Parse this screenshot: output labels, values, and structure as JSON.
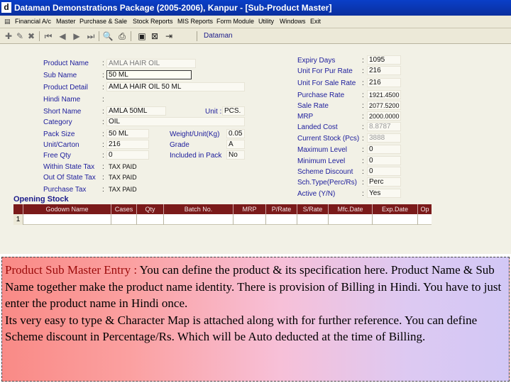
{
  "window": {
    "title": "Dataman Demonstrations Package (2005-2006), Kanpur - [Sub-Product Master]",
    "icon_glyph": "d"
  },
  "menu": {
    "items": [
      "Financial A/c",
      "Master",
      "Purchase & Sale",
      "Stock Reports",
      "MIS Reports",
      "Form Module",
      "Utility",
      "Windows",
      "Exit"
    ]
  },
  "toolbar": {
    "company": "Dataman",
    "buttons": [
      "add-icon",
      "edit-icon",
      "delete-icon",
      "first-record-icon",
      "previous-record-icon",
      "next-record-icon",
      "last-record-icon",
      "find-icon",
      "print-icon",
      "save-icon",
      "cancel-icon",
      "exit-icon"
    ]
  },
  "form_left": {
    "product_name": {
      "label": "Product Name",
      "value": "AMLA HAIR OIL"
    },
    "sub_name": {
      "label": "Sub Name",
      "value": "50 ML"
    },
    "product_detail": {
      "label": "Product Detail",
      "value": "AMLA HAIR OIL 50 ML"
    },
    "hindi_name": {
      "label": "Hindi Name",
      "value": ""
    },
    "short_name": {
      "label": "Short Name",
      "value": "AMLA 50ML"
    },
    "unit": {
      "label": "Unit :",
      "value": "PCS."
    },
    "category": {
      "label": "Category",
      "value": "OIL"
    },
    "pack_size": {
      "label": "Pack Size",
      "value": "50 ML"
    },
    "weight_unit": {
      "label": "Weight/Unit(Kg)",
      "value": "0.05"
    },
    "unit_carton": {
      "label": "Unit/Carton",
      "value": "216"
    },
    "grade": {
      "label": "Grade",
      "value": "A"
    },
    "free_qty": {
      "label": "Free Qty",
      "value": "0"
    },
    "included_in_pack": {
      "label": "Included in Pack",
      "value": "No"
    },
    "within_state_tax": {
      "label": "Within State Tax",
      "value": "TAX PAID"
    },
    "out_of_state_tax": {
      "label": "Out Of State Tax",
      "value": "TAX PAID"
    },
    "purchase_tax": {
      "label": "Purchase Tax",
      "value": "TAX PAID"
    }
  },
  "form_right": {
    "expiry_days": {
      "label": "Expiry Days",
      "value": "1095"
    },
    "unit_for_pur_rate": {
      "label": "Unit For Pur Rate",
      "value": "216"
    },
    "unit_for_sale_rate": {
      "label": "Unit For Sale Rate",
      "value": "216"
    },
    "purchase_rate": {
      "label": "Purchase Rate",
      "value": "1921.4500"
    },
    "sale_rate": {
      "label": "Sale Rate",
      "value": "2077.5200"
    },
    "mrp": {
      "label": "MRP",
      "value": "2000.0000"
    },
    "landed_cost": {
      "label": "Landed Cost",
      "value": "8.8787"
    },
    "current_stock": {
      "label": "Current Stock (Pcs)",
      "value": "3888"
    },
    "maximum_level": {
      "label": "Maximum Level",
      "value": "0"
    },
    "minimum_level": {
      "label": "Minimum Level",
      "value": "0"
    },
    "scheme_discount": {
      "label": "Scheme Discount",
      "value": "0"
    },
    "sch_type": {
      "label": "Sch.Type(Perc/Rs)",
      "value": "Perc"
    },
    "active": {
      "label": "Active (Y/N)",
      "value": "Yes"
    }
  },
  "opening_stock": {
    "title": "Opening Stock",
    "columns": [
      "Godown Name",
      "Cases",
      "Qty",
      "Batch No.",
      "MRP",
      "P/Rate",
      "S/Rate",
      "Mfc.Date",
      "Exp.Date",
      "Op"
    ],
    "rows": [
      {
        "num": "1",
        "cells": [
          "",
          "",
          "",
          "",
          "",
          "",
          "",
          "",
          "",
          ""
        ]
      }
    ]
  },
  "caption": {
    "heading": "Product Sub Master Entry :",
    "body": " You can define the product & its specification here. Product Name & Sub Name together make the product name identity. There is provision of Billing in Hindi. You have to just enter the product name in Hindi once.",
    "body2": "Its very easy to type & Character Map is attached along with for further reference. You can define Scheme discount in Percentage/Rs. Which will be Auto deducted at the time of Billing."
  },
  "colors": {
    "title_bar": "#0a3fc8",
    "label_text": "#1c1c9c",
    "grid_header": "#7a1a1a",
    "caption_heading": "#9b0a0a"
  }
}
